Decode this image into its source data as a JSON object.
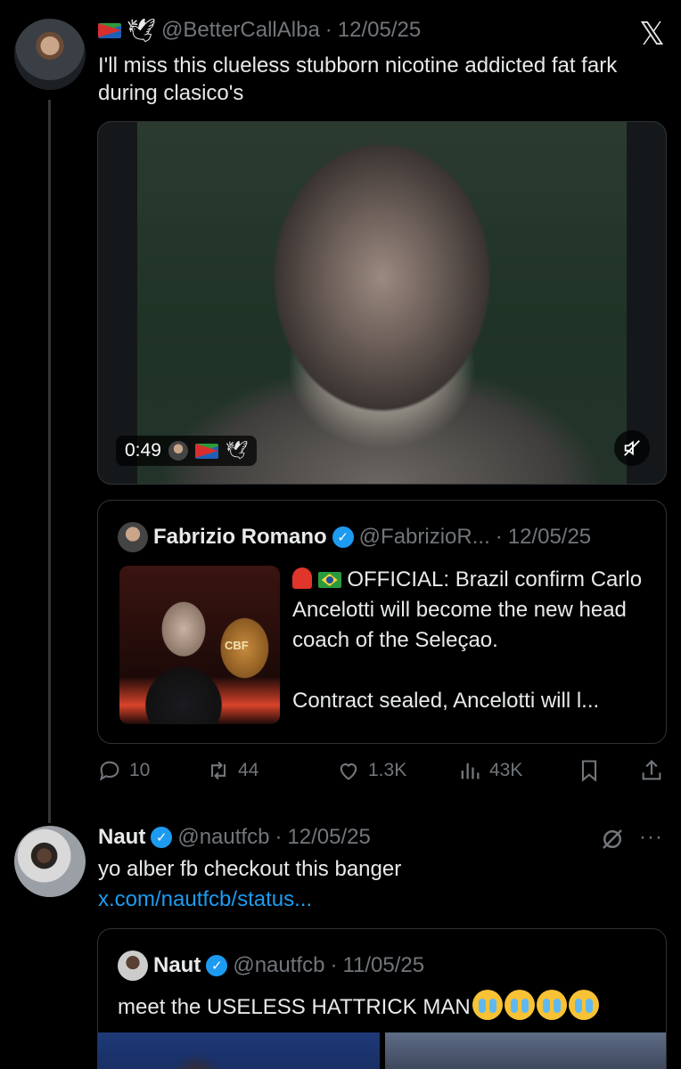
{
  "app": {
    "logo": "𝕏"
  },
  "tweet1": {
    "handle": "@BetterCallAlba",
    "separator": "·",
    "date": "12/05/25",
    "text": "I'll miss this clueless stubborn nicotine addicted fat fark during clasico's",
    "video": {
      "duration": "0:49"
    },
    "quote": {
      "name": "Fabrizio Romano",
      "handle": "@FabrizioR...",
      "separator": "·",
      "date": "12/05/25",
      "text_line1": "OFFICIAL: Brazil confirm Carlo Ancelotti will become the new head coach of the Seleçao.",
      "text_line2": "Contract sealed, Ancelotti will l...",
      "thumb_label": "CBF"
    },
    "stats": {
      "replies": "10",
      "reposts": "44",
      "likes": "1.3K",
      "views": "43K"
    }
  },
  "tweet2": {
    "name": "Naut",
    "handle": "@nautfcb",
    "separator": "·",
    "date": "12/05/25",
    "text": "yo alber fb checkout this banger",
    "link": "x.com/nautfcb/status...",
    "more": "···",
    "quote": {
      "name": "Naut",
      "handle": "@nautfcb",
      "separator": "·",
      "date": "11/05/25",
      "text": "meet the USELESS HATTRICK MAN"
    }
  },
  "colors": {
    "background": "#000000",
    "text": "#e7e9ea",
    "muted": "#71767b",
    "accent": "#1d9bf0",
    "border": "#2f3336"
  }
}
